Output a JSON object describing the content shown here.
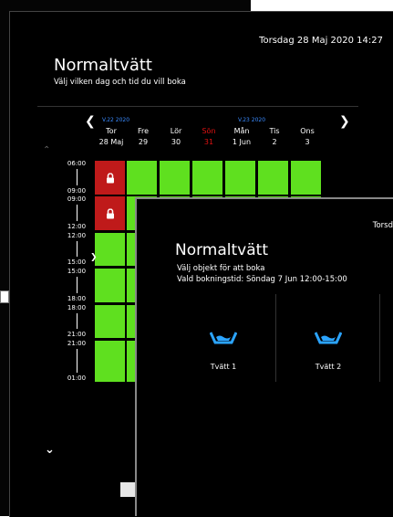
{
  "back_screen": {
    "datetime": "Torsdag 28 Maj 2020  14:27",
    "title": "Normaltvätt",
    "subtitle": "Välj vilken dag och tid du vill boka",
    "weeks": [
      "V.22 2020",
      "V.23 2020"
    ],
    "days": [
      {
        "name": "Tor",
        "date": "28 Maj",
        "color": "#ffffff"
      },
      {
        "name": "Fre",
        "date": "29",
        "color": "#ffffff"
      },
      {
        "name": "Lör",
        "date": "30",
        "color": "#ffffff"
      },
      {
        "name": "Sön",
        "date": "31",
        "color": "#e11111"
      },
      {
        "name": "Mån",
        "date": "1 Jun",
        "color": "#ffffff"
      },
      {
        "name": "Tis",
        "date": "2",
        "color": "#ffffff"
      },
      {
        "name": "Ons",
        "date": "3",
        "color": "#ffffff"
      }
    ],
    "time_slots": [
      {
        "start": "06:00",
        "end": "09:00"
      },
      {
        "start": "09:00",
        "end": "12:00"
      },
      {
        "start": "12:00",
        "end": "15:00"
      },
      {
        "start": "15:00",
        "end": "18:00"
      },
      {
        "start": "18:00",
        "end": "21:00"
      },
      {
        "start": "21:00",
        "end": "01:00"
      }
    ],
    "colors": {
      "available": "#5fe01f",
      "booked": "#bf1a1a"
    }
  },
  "front_screen": {
    "header_partial": "Torsd",
    "title": "Normaltvätt",
    "subtitle": "Välj objekt för att boka",
    "selected_time": "Vald bokningstid: Söndag 7 Jun 12:00-15:00",
    "objects": [
      {
        "label": "Tvätt 1"
      },
      {
        "label": "Tvätt 2"
      }
    ]
  }
}
